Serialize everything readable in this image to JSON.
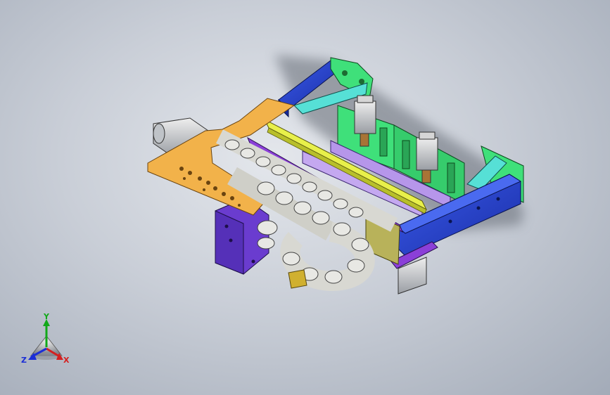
{
  "triad": {
    "x_label": "X",
    "y_label": "Y",
    "z_label": "Z",
    "x_color": "#d42020",
    "y_color": "#12a81a",
    "z_color": "#1b2ed6"
  },
  "colors": {
    "frame_blue": "#2541c9",
    "plate_orange": "#f2b24a",
    "bracket_green": "#3fe07a",
    "bracket_cyan": "#56e0d6",
    "rail_purple": "#8b3fd8",
    "rod_yellow": "#e8f04a",
    "plate_olive": "#b8b25a",
    "chain_grey": "#d8d8d2",
    "housing_violet": "#6a3ccf"
  }
}
